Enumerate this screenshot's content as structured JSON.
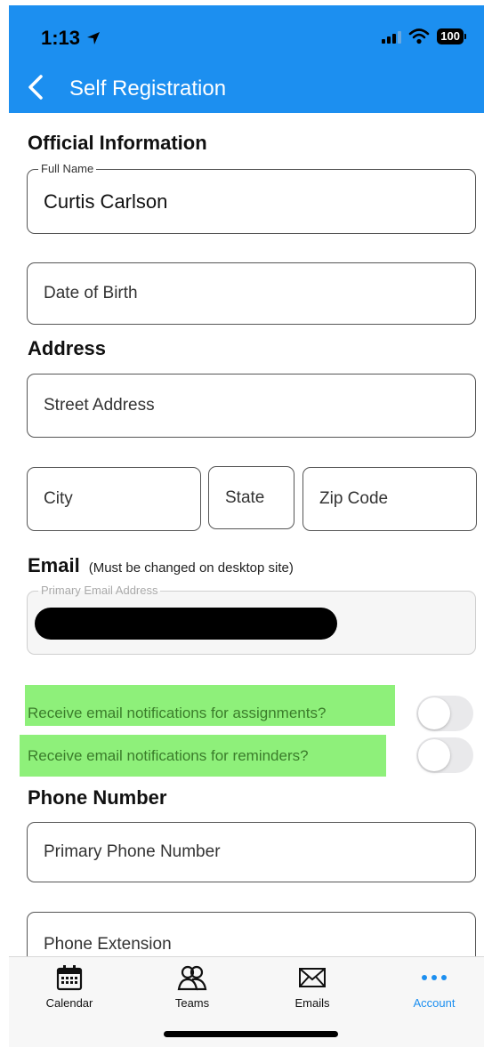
{
  "status_bar": {
    "time": "1:13",
    "battery": "100"
  },
  "nav": {
    "title": "Self Registration"
  },
  "official": {
    "heading": "Official Information",
    "full_name_label": "Full Name",
    "full_name_value": "Curtis Carlson",
    "dob_placeholder": "Date of Birth"
  },
  "address": {
    "heading": "Address",
    "street_placeholder": "Street Address",
    "city_placeholder": "City",
    "state_placeholder": "State",
    "zip_placeholder": "Zip Code"
  },
  "email": {
    "heading": "Email",
    "note": "(Must be changed on desktop site)",
    "primary_label": "Primary Email Address"
  },
  "notifications": {
    "assignments_label": "Receive email notifications for assignments?",
    "assignments_on": false,
    "reminders_label": "Receive email notifications for reminders?",
    "reminders_on": false,
    "highlight_color": "#8ef07a"
  },
  "phone": {
    "heading": "Phone Number",
    "primary_placeholder": "Primary Phone Number",
    "extension_placeholder": "Phone Extension"
  },
  "tabbar": {
    "tabs": [
      {
        "label": "Calendar",
        "icon": "calendar-icon",
        "active": false
      },
      {
        "label": "Teams",
        "icon": "teams-icon",
        "active": false
      },
      {
        "label": "Emails",
        "icon": "envelope-icon",
        "active": false
      },
      {
        "label": "Account",
        "icon": "more-dots-icon",
        "active": true
      }
    ]
  },
  "colors": {
    "accent": "#1c8ff0",
    "header_bg": "#1c8ff0"
  }
}
